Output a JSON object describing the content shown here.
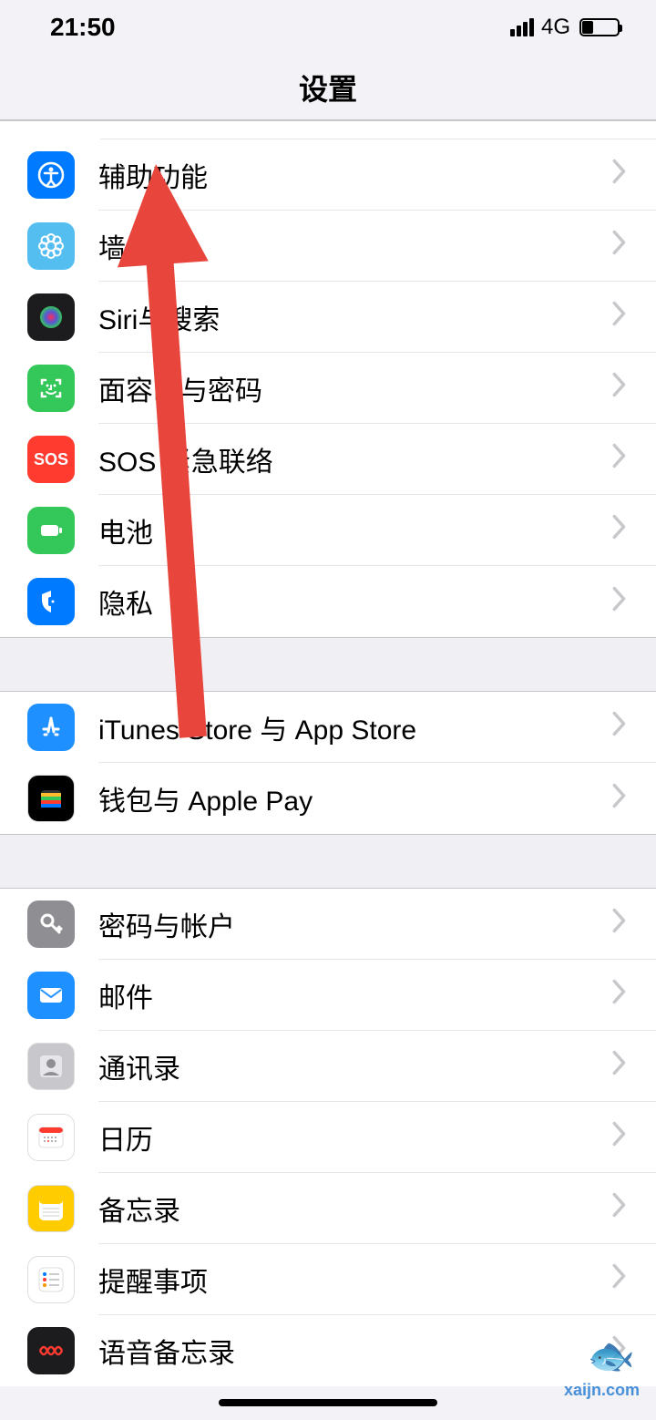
{
  "status": {
    "time": "21:50",
    "network": "4G"
  },
  "header": {
    "title": "设置"
  },
  "groups": [
    {
      "partialTop": true,
      "items": [
        {
          "id": "accessibility",
          "label": "辅助功能",
          "icon": "accessibility-icon",
          "bg": "#007aff"
        },
        {
          "id": "wallpaper",
          "label": "墙纸",
          "icon": "wallpaper-icon",
          "bg": "#55bef0"
        },
        {
          "id": "siri",
          "label": "Siri与搜索",
          "icon": "siri-icon",
          "bg": "#1c1c1e"
        },
        {
          "id": "faceid",
          "label": "面容ID与密码",
          "icon": "faceid-icon",
          "bg": "#34c759"
        },
        {
          "id": "sos",
          "label": "SOS 紧急联络",
          "icon": "sos-icon",
          "bg": "#ff3b30"
        },
        {
          "id": "battery",
          "label": "电池",
          "icon": "battery-icon",
          "bg": "#34c759"
        },
        {
          "id": "privacy",
          "label": "隐私",
          "icon": "privacy-icon",
          "bg": "#007aff"
        }
      ]
    },
    {
      "items": [
        {
          "id": "itunes",
          "label": "iTunes Store 与 App Store",
          "icon": "appstore-icon",
          "bg": "#1e90ff"
        },
        {
          "id": "wallet",
          "label": "钱包与 Apple Pay",
          "icon": "wallet-icon",
          "bg": "#000000"
        }
      ]
    },
    {
      "items": [
        {
          "id": "passwords",
          "label": "密码与帐户",
          "icon": "key-icon",
          "bg": "#8e8e93"
        },
        {
          "id": "mail",
          "label": "邮件",
          "icon": "mail-icon",
          "bg": "#1e90ff"
        },
        {
          "id": "contacts",
          "label": "通讯录",
          "icon": "contacts-icon",
          "bg": "#c7c7cc"
        },
        {
          "id": "calendar",
          "label": "日历",
          "icon": "calendar-icon",
          "bg": "#ffffff"
        },
        {
          "id": "notes",
          "label": "备忘录",
          "icon": "notes-icon",
          "bg": "#ffcc00"
        },
        {
          "id": "reminders",
          "label": "提醒事项",
          "icon": "reminders-icon",
          "bg": "#ffffff"
        },
        {
          "id": "voicememos",
          "label": "语音备忘录",
          "icon": "voicememos-icon",
          "bg": "#1c1c1e"
        }
      ]
    }
  ],
  "watermark": {
    "text": "xaijn.com"
  }
}
